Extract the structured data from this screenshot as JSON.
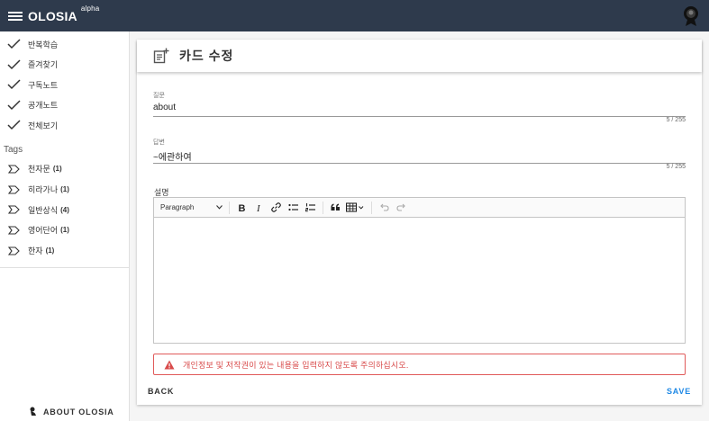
{
  "appbar": {
    "brand": "OLOSIA",
    "badge": "alpha",
    "menu_icon": "hamburger-icon",
    "avatar_icon": "user-avatar-icon"
  },
  "sidebar": {
    "nav_items": [
      {
        "label": "반복학습",
        "icon": "check-icon"
      },
      {
        "label": "즐겨찾기",
        "icon": "check-icon"
      },
      {
        "label": "구독노트",
        "icon": "check-icon"
      },
      {
        "label": "공개노트",
        "icon": "check-icon"
      },
      {
        "label": "전체보기",
        "icon": "check-icon"
      }
    ],
    "tags_title": "Tags",
    "tags": [
      {
        "label": "천자문",
        "count": "(1)"
      },
      {
        "label": "히라가나",
        "count": "(1)"
      },
      {
        "label": "일반상식",
        "count": "(4)"
      },
      {
        "label": "영어단어",
        "count": "(1)"
      },
      {
        "label": "한자",
        "count": "(1)"
      }
    ],
    "about_label": "ABOUT OLOSIA"
  },
  "card": {
    "title": "카드 수정",
    "title_icon": "edit-note-icon",
    "question": {
      "label": "질문",
      "value": "about",
      "counter": "5 / 255"
    },
    "answer": {
      "label": "답변",
      "value": "~에관하여",
      "counter": "5 / 255"
    },
    "description_label": "설명",
    "editor": {
      "paragraph_select": "Paragraph",
      "tools": [
        "bold-icon",
        "italic-icon",
        "link-icon",
        "bulleted-list-icon",
        "numbered-list-icon",
        "blockquote-icon",
        "table-icon",
        "undo-icon",
        "redo-icon"
      ]
    },
    "warning": "개인정보 및 저작권이 있는 내용을 입력하지 않도록 주의하십시오.",
    "back_label": "BACK",
    "save_label": "SAVE"
  },
  "colors": {
    "appbar": "#2e3a4c",
    "accent": "#1e88e5",
    "warning": "#d84a4a"
  }
}
